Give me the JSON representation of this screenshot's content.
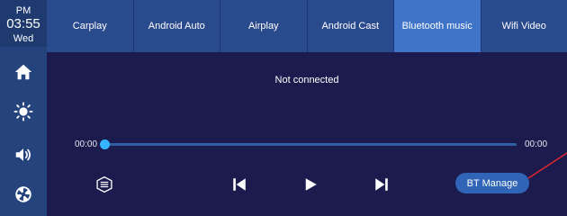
{
  "clock": {
    "ampm": "PM",
    "time": "03:55",
    "day": "Wed"
  },
  "sidebar": {
    "items": [
      {
        "icon": "home-icon"
      },
      {
        "icon": "brightness-icon"
      },
      {
        "icon": "volume-icon"
      },
      {
        "icon": "settings-icon"
      }
    ]
  },
  "tabs": [
    {
      "label": "Carplay"
    },
    {
      "label": "Android Auto"
    },
    {
      "label": "Airplay"
    },
    {
      "label": "Android Cast"
    },
    {
      "label": "Bluetooth music",
      "active": true
    },
    {
      "label": "Wifi Video"
    }
  ],
  "player": {
    "status": "Not connected",
    "elapsed": "00:00",
    "duration": "00:00",
    "progress": 0
  },
  "controls": {
    "menu_icon": "playlist-icon",
    "prev_icon": "skip-previous-icon",
    "play_icon": "play-icon",
    "next_icon": "skip-next-icon",
    "bt_manage_label": "BT Manage"
  },
  "colors": {
    "background": "#1c1b4e",
    "sidebar": "#25447d",
    "tabbar": "#2a4a8e",
    "active_tab": "#3f74c8",
    "progress": "#35b5ff",
    "button": "#2f64b6",
    "annotation": "#e0262f"
  }
}
